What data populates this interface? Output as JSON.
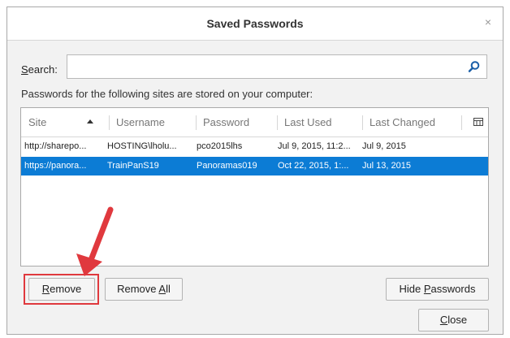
{
  "window": {
    "title": "Saved Passwords",
    "close_glyph": "×"
  },
  "search": {
    "label_first": "S",
    "label_rest": "earch:",
    "value": "",
    "icon": "search-icon"
  },
  "info_text": "Passwords for the following sites are stored on your computer:",
  "table": {
    "columns": [
      "Site",
      "Username",
      "Password",
      "Last Used",
      "Last Changed"
    ],
    "sort_indicator": "ascending",
    "column_picker_icon": "column-picker-icon",
    "rows": [
      {
        "site": "http://sharepo...",
        "username": "HOSTING\\lholu...",
        "password": "pco2015lhs",
        "last_used": "Jul 9, 2015, 11:2...",
        "last_changed": "Jul 9, 2015",
        "selected": false
      },
      {
        "site": "https://panora...",
        "username": "TrainPanS19",
        "password": "Panoramas019",
        "last_used": "Oct 22, 2015, 1:...",
        "last_changed": "Jul 13, 2015",
        "selected": true
      }
    ],
    "selection_color": "#0c7cd5"
  },
  "buttons": {
    "remove": {
      "underline": "R",
      "rest": "emove"
    },
    "remove_all": {
      "prefix": "Remove ",
      "underline": "A",
      "rest": "ll"
    },
    "hide_passwords": {
      "prefix": "Hide ",
      "underline": "P",
      "rest": "asswords"
    },
    "close": {
      "underline": "C",
      "rest": "lose"
    }
  },
  "annotation": {
    "color": "#e0393e",
    "target": "remove-button"
  }
}
